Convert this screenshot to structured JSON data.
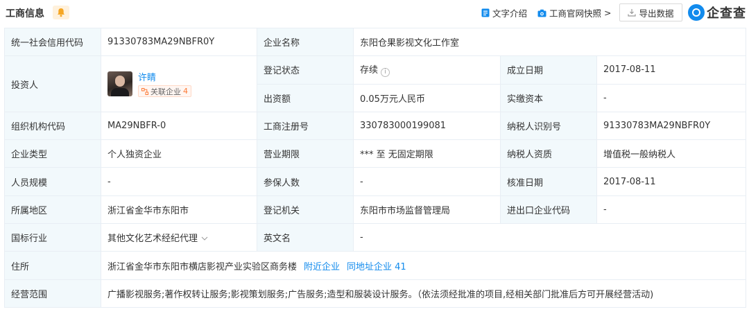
{
  "header": {
    "title": "工商信息",
    "text_intro_label": "文字介绍",
    "snapshot_label": "工商官网快照",
    "snapshot_chevron": ">",
    "export_label": "导出数据",
    "logo_text": "企查查"
  },
  "colors": {
    "accent": "#128bed",
    "label_bg": "#f2f9fc",
    "badge_orange": "#fd7a36",
    "bell": "#f5a623"
  },
  "rows": {
    "credit_code_label": "统一社会信用代码",
    "credit_code": "91330783MA29NBFR0Y",
    "company_name_label": "企业名称",
    "company_name": "东阳仓果影视文化工作室",
    "investor_label": "投资人",
    "investor_name": "许睛",
    "related_label": "关联企业",
    "related_count": "4",
    "reg_status_label": "登记状态",
    "reg_status": "存续",
    "established_label": "成立日期",
    "established": "2017-08-11",
    "capital_label": "出资额",
    "capital": "0.05万元人民币",
    "paid_capital_label": "实缴资本",
    "paid_capital": "-",
    "org_code_label": "组织机构代码",
    "org_code": "MA29NBFR-0",
    "reg_no_label": "工商注册号",
    "reg_no": "330783000199081",
    "taxpayer_id_label": "纳税人识别号",
    "taxpayer_id": "91330783MA29NBFR0Y",
    "company_type_label": "企业类型",
    "company_type": "个人独资企业",
    "term_label": "营业期限",
    "term": "*** 至 无固定期限",
    "taxpayer_qual_label": "纳税人资质",
    "taxpayer_qual": "增值税一般纳税人",
    "staff_label": "人员规模",
    "staff": "-",
    "insured_label": "参保人数",
    "insured": "-",
    "approval_label": "核准日期",
    "approval": "2017-08-11",
    "region_label": "所属地区",
    "region": "浙江省金华市东阳市",
    "authority_label": "登记机关",
    "authority": "东阳市市场监督管理局",
    "import_export_label": "进出口企业代码",
    "import_export": "-",
    "industry_label": "国标行业",
    "industry": "其他文化艺术经纪代理",
    "english_name_label": "英文名",
    "english_name": "-",
    "address_label": "住所",
    "address": "浙江省金华市东阳市横店影视产业实验区商务楼",
    "nearby_link": "附近企业",
    "same_address_link": "同地址企业 41",
    "scope_label": "经营范围",
    "scope": "广播影视服务;著作权转让服务;影视策划服务;广告服务;造型和服装设计服务。（依法须经批准的项目,经相关部门批准后方可开展经营活动)"
  }
}
